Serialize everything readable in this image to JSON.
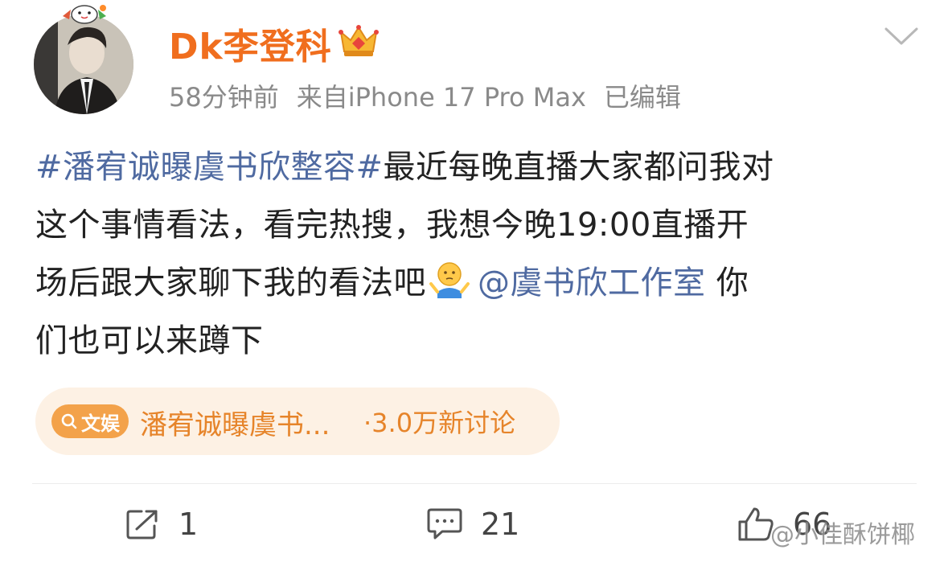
{
  "post": {
    "author": {
      "name": "Dk李登科",
      "verified_icon": "vip-crown-icon"
    },
    "meta": {
      "time": "58分钟前",
      "source": "来自iPhone 17 Pro Max",
      "edited": "已编辑"
    },
    "text": {
      "hashtag": "#潘宥诚曝虞书欣整容#",
      "line1_rest": "最近每晚直播大家都问我对",
      "line2": "这个事情看法，看完热搜，我想今晚19:00直播开",
      "line3_start": "场后跟大家聊下我的看法吧",
      "emoji": "shrug-emoji",
      "mention": "@虞书欣工作室",
      "line3_end": " 你",
      "line4": "们也可以来蹲下"
    },
    "trend": {
      "tag": "文娱",
      "topic": "潘宥诚曝虞书...",
      "count": "·3.0万新讨论"
    },
    "actions": {
      "repost_count": "1",
      "comment_count": "21",
      "like_count": "66"
    }
  },
  "watermark": "@小佳酥饼椰",
  "colors": {
    "username": "#f06e1e",
    "link": "#4f6aa1",
    "meta": "#8a8a8a",
    "trend_bg": "#fdf1e4",
    "trend_text": "#e6842a",
    "trend_tag_bg": "#f3a24a"
  }
}
